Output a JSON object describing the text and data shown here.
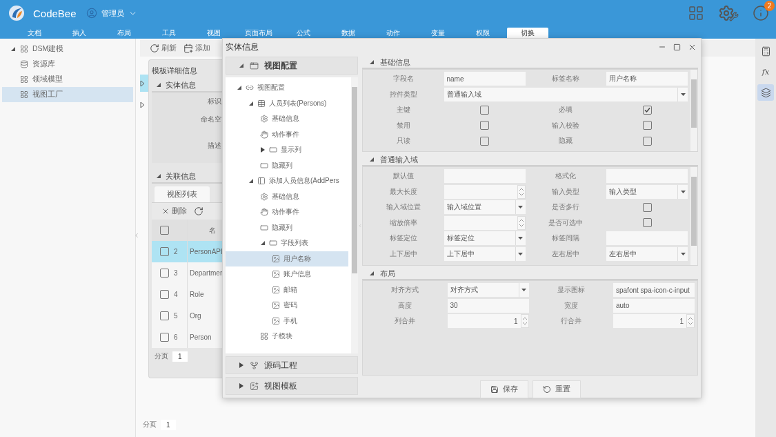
{
  "app": {
    "name": "CodeBee",
    "user": "管理员",
    "notification_count": "2"
  },
  "menu": [
    {
      "label": "文档",
      "selected": false
    },
    {
      "label": "插入",
      "selected": false
    },
    {
      "label": "布局",
      "selected": false
    },
    {
      "label": "工具",
      "selected": false
    },
    {
      "label": "视图",
      "selected": false
    },
    {
      "label": "页面布局",
      "selected": false
    },
    {
      "label": "公式",
      "selected": false
    },
    {
      "label": "数据",
      "selected": false
    },
    {
      "label": "动作",
      "selected": false
    },
    {
      "label": "变量",
      "selected": false
    },
    {
      "label": "权限",
      "selected": false
    },
    {
      "label": "切换",
      "selected": true
    }
  ],
  "sidebar": {
    "items": [
      {
        "label": "DSM建模",
        "kind": "grid",
        "expanded": true,
        "selected": false,
        "children": [
          {
            "label": "资源库",
            "kind": "database",
            "selected": false
          },
          {
            "label": "领域模型",
            "kind": "grid",
            "selected": false
          },
          {
            "label": "视图工厂",
            "kind": "grid",
            "selected": true
          }
        ]
      }
    ]
  },
  "toolbar": [
    "刷新",
    "添加"
  ],
  "list_rows": [
    {
      "selected": true
    },
    {
      "selected": false
    }
  ],
  "detail_panel": {
    "title": "模板详细信息",
    "entity_section": {
      "title": "实体信息",
      "expanded": true,
      "labels": [
        "标识",
        "命名空",
        "描述"
      ]
    },
    "relation_section": {
      "title": "关联信息",
      "expanded": true,
      "tabs": [
        {
          "label": "视图列表",
          "selected": true
        }
      ],
      "toolbar": [
        "删除"
      ],
      "header_checked": false,
      "header": "名",
      "rows": [
        {
          "index": "2",
          "name": "PersonAPI",
          "selected": true,
          "checked": false
        },
        {
          "index": "3",
          "name": "Departmen",
          "selected": false,
          "checked": false
        },
        {
          "index": "4",
          "name": "Role",
          "selected": false,
          "checked": false
        },
        {
          "index": "5",
          "name": "Org",
          "selected": false,
          "checked": false
        },
        {
          "index": "6",
          "name": "Person",
          "selected": false,
          "checked": false
        }
      ],
      "pager": {
        "label": "分页",
        "page": "1"
      }
    }
  },
  "pager": {
    "label": "分页",
    "page": "1"
  },
  "right_rail": [
    {
      "kind": "calculator",
      "selected": false
    },
    {
      "kind": "formula",
      "label": "fx",
      "selected": false
    },
    {
      "kind": "layers",
      "selected": true
    }
  ],
  "dialog": {
    "title": "实体信息",
    "nav": [
      {
        "title": "视图配置",
        "kind": "window",
        "expanded": true,
        "tree": [
          {
            "label": "视图配置",
            "kind": "link",
            "expanded": true,
            "selected": false,
            "children": [
              {
                "label": "人员列表(Persons)",
                "kind": "table",
                "expanded": true,
                "selected": false,
                "children": [
                  {
                    "label": "基础信息",
                    "kind": "gear",
                    "selected": false
                  },
                  {
                    "label": "动作事件",
                    "kind": "hand",
                    "selected": false
                  },
                  {
                    "label": "显示列",
                    "kind": "field",
                    "expanded": false,
                    "selected": false
                  },
                  {
                    "label": "隐藏列",
                    "kind": "box",
                    "selected": false
                  }
                ]
              },
              {
                "label": "添加人员信息(AddPers",
                "kind": "form",
                "expanded": true,
                "selected": false,
                "children": [
                  {
                    "label": "基础信息",
                    "kind": "gear",
                    "selected": false
                  },
                  {
                    "label": "动作事件",
                    "kind": "hand",
                    "selected": false
                  },
                  {
                    "label": "隐藏列",
                    "kind": "box",
                    "selected": false
                  },
                  {
                    "label": "字段列表",
                    "kind": "field",
                    "expanded": true,
                    "selected": false,
                    "children": [
                      {
                        "label": "用户名称",
                        "kind": "input",
                        "selected": true
                      },
                      {
                        "label": "账户信息",
                        "kind": "input",
                        "selected": false
                      },
                      {
                        "label": "邮箱",
                        "kind": "input",
                        "selected": false
                      },
                      {
                        "label": "密码",
                        "kind": "input",
                        "selected": false
                      },
                      {
                        "label": "手机",
                        "kind": "input",
                        "selected": false
                      }
                    ]
                  },
                  {
                    "label": "子模块",
                    "kind": "modules",
                    "selected": false
                  }
                ]
              }
            ]
          }
        ]
      },
      {
        "title": "源码工程",
        "kind": "fork",
        "expanded": false
      },
      {
        "title": "视图模板",
        "kind": "image",
        "expanded": false
      }
    ],
    "sections": [
      {
        "title": "基础信息",
        "expanded": true,
        "fields": [
          {
            "label": "字段名",
            "kind": "text",
            "value": "name"
          },
          {
            "label": "标签名称",
            "kind": "text",
            "value": "用户名称"
          },
          {
            "label": "控件类型",
            "kind": "wide-select",
            "value": "普通输入域"
          },
          {
            "label": "主键",
            "kind": "checkbox",
            "checked": false
          },
          {
            "label": "必填",
            "kind": "checkbox",
            "checked": true
          },
          {
            "label": "禁用",
            "kind": "checkbox",
            "checked": false
          },
          {
            "label": "输入校验",
            "kind": "checkbox",
            "checked": false
          },
          {
            "label": "只读",
            "kind": "checkbox",
            "checked": false
          },
          {
            "label": "隐藏",
            "kind": "checkbox",
            "checked": false
          }
        ]
      },
      {
        "title": "普通输入域",
        "expanded": true,
        "fields": [
          {
            "label": "默认值",
            "kind": "text"
          },
          {
            "label": "格式化",
            "kind": "text"
          },
          {
            "label": "最大长度",
            "kind": "number"
          },
          {
            "label": "输入类型",
            "kind": "select",
            "value": "输入类型"
          },
          {
            "label": "输入域位置",
            "kind": "select",
            "value": "输入域位置"
          },
          {
            "label": "是否多行",
            "kind": "checkbox",
            "checked": false
          },
          {
            "label": "缩放倍率",
            "kind": "number"
          },
          {
            "label": "是否可选中",
            "kind": "checkbox",
            "checked": false
          },
          {
            "label": "标签定位",
            "kind": "select",
            "value": "标签定位"
          },
          {
            "label": "标签间隔",
            "kind": "text"
          },
          {
            "label": "上下居中",
            "kind": "select",
            "value": "上下居中"
          },
          {
            "label": "左右居中",
            "kind": "select",
            "value": "左右居中"
          }
        ]
      },
      {
        "title": "布局",
        "expanded": true,
        "fields": [
          {
            "label": "对齐方式",
            "kind": "select",
            "value": "对齐方式"
          },
          {
            "label": "显示图标",
            "kind": "text",
            "value": "spafont spa-icon-c-input"
          },
          {
            "label": "高度",
            "kind": "text",
            "value": "30"
          },
          {
            "label": "宽度",
            "kind": "text",
            "value": "auto"
          },
          {
            "label": "列合并",
            "kind": "number",
            "value": "1"
          },
          {
            "label": "行合并",
            "kind": "number",
            "value": "1"
          }
        ]
      }
    ],
    "buttons": [
      "保存",
      "重置"
    ]
  }
}
